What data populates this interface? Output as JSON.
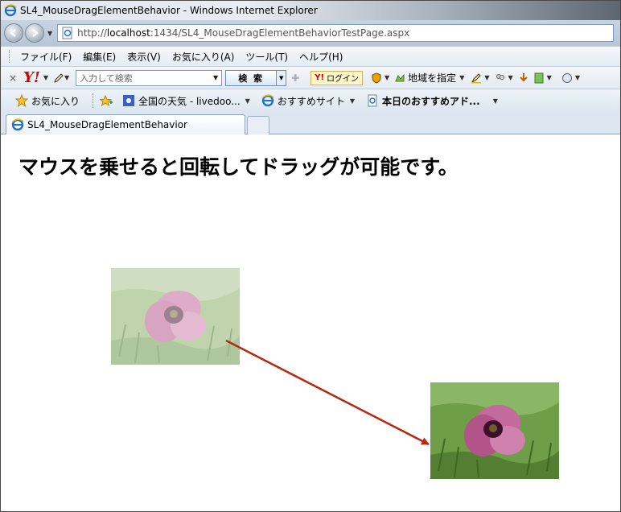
{
  "window": {
    "title": "SL4_MouseDragElementBehavior - Windows Internet Explorer"
  },
  "address": {
    "prefix": "http://",
    "host": "localhost",
    "path": ":1434/SL4_MouseDragElementBehaviorTestPage.aspx"
  },
  "menu": {
    "items": [
      "ファイル(F)",
      "編集(E)",
      "表示(V)",
      "お気に入り(A)",
      "ツール(T)",
      "ヘルプ(H)"
    ]
  },
  "yahoo_toolbar": {
    "close": "×",
    "logo": "Y!",
    "search_placeholder": "入力して検索",
    "search_button": "検 索",
    "login": "ログイン",
    "login_mark": "Y!",
    "region": "地域を指定"
  },
  "favorites": {
    "label": "お気に入り",
    "items": [
      "全国の天気 - livedoo...",
      "おすすめサイト",
      "本日のおすすめアド..."
    ]
  },
  "tab": {
    "label": "SL4_MouseDragElementBehavior"
  },
  "content": {
    "heading": "マウスを乗せると回転してドラッグが可能です。"
  },
  "colors": {
    "arrow": "#b52a12"
  }
}
